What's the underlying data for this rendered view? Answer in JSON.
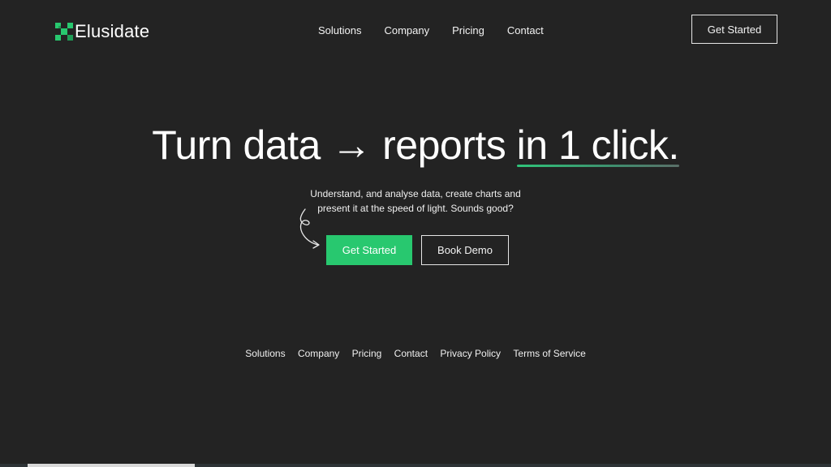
{
  "brand": {
    "name": "Elusidate",
    "accent_color": "#28c86f",
    "logo_icon": "pixel-x-logo-icon"
  },
  "header": {
    "nav": [
      "Solutions",
      "Company",
      "Pricing",
      "Contact"
    ],
    "cta_label": "Get Started"
  },
  "hero": {
    "title_start": "Turn data → reports ",
    "title_highlight": "in 1 click.",
    "subtitle_line1": "Understand, and analyse data, create charts and",
    "subtitle_line2": "present it at the speed of light. Sounds good?",
    "primary_button": "Get Started",
    "secondary_button": "Book Demo",
    "doodle_icon": "curly-arrow-icon"
  },
  "footer": {
    "links": [
      "Solutions",
      "Company",
      "Pricing",
      "Contact",
      "Privacy Policy",
      "Terms of Service"
    ]
  }
}
